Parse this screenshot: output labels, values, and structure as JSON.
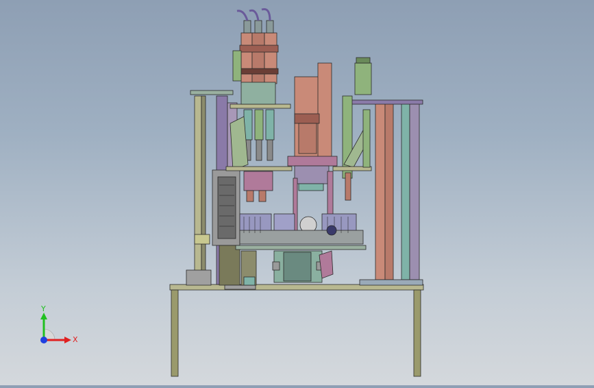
{
  "viewport": {
    "background_top": "#8e9fb4",
    "background_bottom": "#d4d8dc"
  },
  "triad": {
    "x_label": "X",
    "y_label": "Y",
    "x_color": "#e02020",
    "y_color": "#20c020",
    "z_color": "#2040e0"
  },
  "colors": {
    "frame": "#9a9a6c",
    "frame_dark": "#6f6f4a",
    "salmon": "#c98a78",
    "salmon_dark": "#9c5e52",
    "teal": "#7fb3a8",
    "green": "#8fb37c",
    "purple": "#8a7aa8",
    "mauve": "#b07a9a",
    "gray": "#8c8c8c",
    "olive": "#b8b890",
    "edge": "#2a2a2a"
  }
}
